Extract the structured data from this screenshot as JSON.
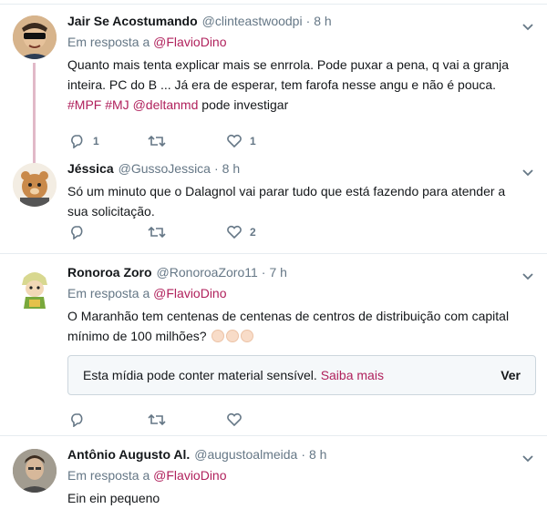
{
  "tweets": [
    {
      "name": "Jair Se Acostumando",
      "handle": "@clinteastwoodpi",
      "time": "8 h",
      "reply_prefix": "Em resposta a",
      "reply_mention": "@FlavioDino",
      "text_plain": "Quanto mais tenta explicar mais se enrrola. Pode puxar a pena, q vai a granja inteira. PC do B ... Já era de esperar, tem farofa nesse angu e não é pouca.",
      "tags": [
        "#MPF",
        "#MJ",
        "@deltanmd"
      ],
      "text_tail": "pode investigar",
      "replies": "1",
      "retweets": "",
      "likes": "1",
      "avatar": "cartoon-sunglasses-avatar"
    },
    {
      "name": "Jéssica",
      "handle": "@GussoJessica",
      "time": "8 h",
      "text": "Só um minuto que o Dalagnol vai parar tudo que está fazendo para atender a sua solicitação.",
      "replies": "",
      "retweets": "",
      "likes": "2",
      "avatar": "cartoon-bear-avatar"
    },
    {
      "name": "Ronoroa Zoro",
      "handle": "@RonoroaZoro11",
      "time": "7 h",
      "reply_prefix": "Em resposta a",
      "reply_mention": "@FlavioDino",
      "text": "O Maranhão tem centenas de centenas de centros de distribuição com capital mínimo de 100 milhões?",
      "media_warning": "Esta mídia pode conter material sensível.",
      "media_more": "Saiba mais",
      "media_view": "Ver",
      "replies": "",
      "retweets": "",
      "likes": "",
      "avatar": "cartoon-character-avatar"
    },
    {
      "name": "Antônio Augusto Al.",
      "handle": "@augustoalmeida",
      "time": "8 h",
      "reply_prefix": "Em resposta a",
      "reply_mention": "@FlavioDino",
      "text": "Ein ein pequeno",
      "avatar": "photo-man-avatar"
    }
  ],
  "dot": "·",
  "colors": {
    "accent": "#b0215c",
    "muted": "#657786",
    "thread": "#e1b9c8"
  }
}
